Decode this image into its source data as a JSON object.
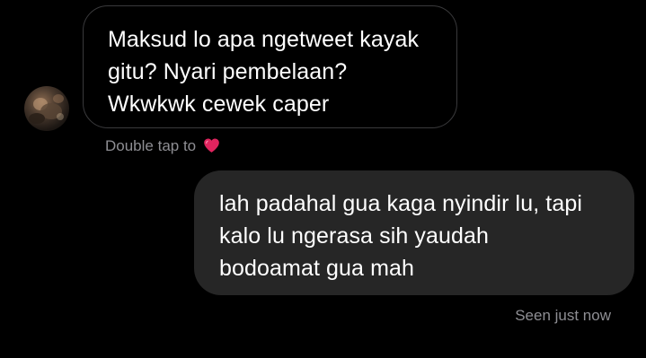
{
  "conversation": {
    "incoming": {
      "avatar_icon": "profile-avatar",
      "text": "Maksud lo apa ngetweet kayak\ngitu? Nyari pembelaan?\nWkwkwk cewek caper",
      "reaction_hint": "Double tap to",
      "reaction_icon": "red-heart-icon"
    },
    "outgoing": {
      "text": "lah padahal gua kaga nyindir lu, tapi\nkalo lu ngerasa sih yaudah\nbodoamat gua mah",
      "status": "Seen just now"
    }
  },
  "colors": {
    "background": "#000000",
    "incoming_bubble_border": "#3a3a3c",
    "outgoing_bubble": "#262626",
    "secondary_text": "#8e8e93",
    "heart": "#e0245e"
  }
}
